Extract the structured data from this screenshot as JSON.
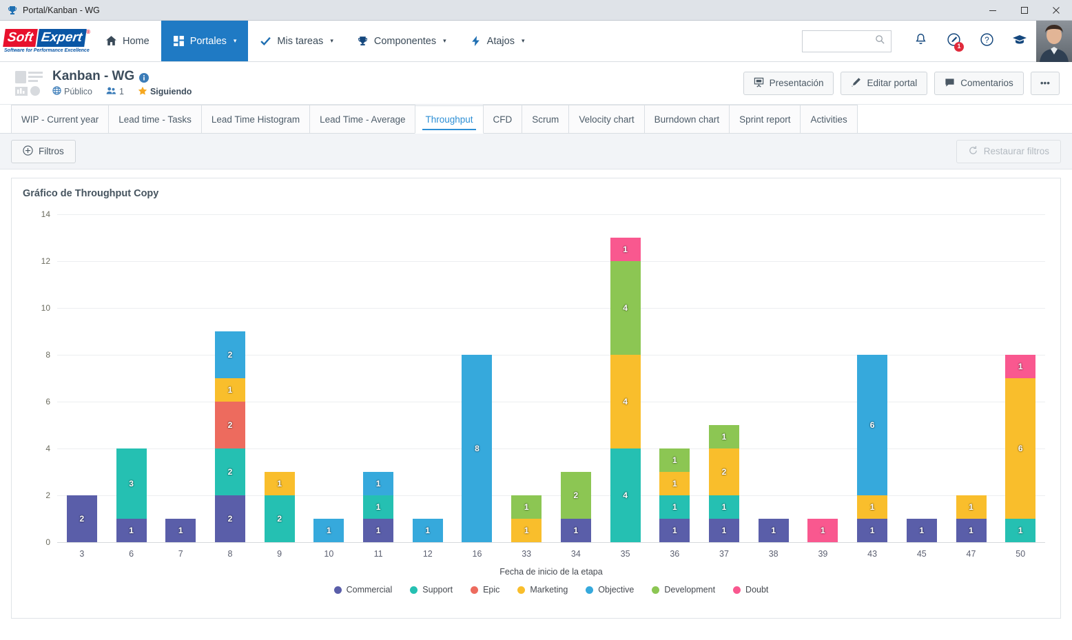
{
  "window": {
    "title": "Portal/Kanban - WG",
    "icon": "trophy-icon",
    "minimize": "—",
    "maximize": "□",
    "close": "×"
  },
  "brand": {
    "soft": "Soft",
    "expert": "Expert",
    "registered": "®",
    "tagline": "Software for Performance Excellence",
    "red": "#e8112d",
    "blue": "#0a56a5"
  },
  "nav": {
    "items": [
      {
        "label": "Home",
        "icon": "home-icon",
        "caret": false,
        "active": false
      },
      {
        "label": "Portales",
        "icon": "grid-icon",
        "caret": true,
        "active": true
      },
      {
        "label": "Mis tareas",
        "icon": "check-icon",
        "caret": true,
        "active": false
      },
      {
        "label": "Componentes",
        "icon": "trophy-icon",
        "caret": true,
        "active": false
      },
      {
        "label": "Atajos",
        "icon": "bolt-icon",
        "caret": true,
        "active": false
      }
    ],
    "caret": "▾",
    "search": {
      "value": "",
      "placeholder": ""
    },
    "icons": [
      {
        "name": "bell-icon",
        "badge": null
      },
      {
        "name": "feedback-icon",
        "badge": "1"
      },
      {
        "name": "help-icon",
        "badge": null
      },
      {
        "name": "academy-icon",
        "badge": null
      }
    ],
    "accent": "#1f7ac4"
  },
  "portal": {
    "title": "Kanban - WG",
    "info_icon": "info-icon",
    "visibility": {
      "icon": "globe-icon",
      "label": "Público"
    },
    "members": {
      "icon": "users-icon",
      "label": "1"
    },
    "following": {
      "icon": "star-icon",
      "label": "Siguiendo"
    },
    "actions": [
      {
        "label": "Presentación",
        "icon": "presentation-icon"
      },
      {
        "label": "Editar portal",
        "icon": "pencil-icon"
      },
      {
        "label": "Comentarios",
        "icon": "comment-icon"
      }
    ],
    "more": "•••"
  },
  "tabs": {
    "items": [
      {
        "label": "WIP - Current year",
        "active": false
      },
      {
        "label": "Lead time - Tasks",
        "active": false
      },
      {
        "label": "Lead Time Histogram",
        "active": false
      },
      {
        "label": "Lead Time - Average",
        "active": false
      },
      {
        "label": "Throughput",
        "active": true
      },
      {
        "label": "CFD",
        "active": false
      },
      {
        "label": "Scrum",
        "active": false
      },
      {
        "label": "Velocity chart",
        "active": false
      },
      {
        "label": "Burndown chart",
        "active": false
      },
      {
        "label": "Sprint report",
        "active": false
      },
      {
        "label": "Activities",
        "active": false
      }
    ]
  },
  "filterbar": {
    "filters_label": "Filtros",
    "filters_icon": "plus-circle-icon",
    "restore_label": "Restaurar filtros",
    "restore_icon": "refresh-icon"
  },
  "chart_data": {
    "type": "bar",
    "stacked": true,
    "title": "Gráfico de Throughput Copy",
    "xlabel": "Fecha de inicio de la etapa",
    "ylabel": "",
    "ylim": [
      0,
      14
    ],
    "yticks": [
      0,
      2,
      4,
      6,
      8,
      10,
      12,
      14
    ],
    "grid": true,
    "legend_position": "bottom",
    "categories": [
      "3",
      "6",
      "7",
      "8",
      "9",
      "10",
      "11",
      "12",
      "16",
      "33",
      "34",
      "35",
      "36",
      "37",
      "38",
      "39",
      "43",
      "45",
      "47",
      "50"
    ],
    "series": [
      {
        "name": "Commercial",
        "color": "#5a5ea9",
        "values": [
          2,
          1,
          1,
          2,
          0,
          0,
          1,
          0,
          0,
          0,
          1,
          0,
          1,
          1,
          1,
          0,
          1,
          1,
          1,
          0
        ]
      },
      {
        "name": "Support",
        "color": "#25c0b2",
        "values": [
          0,
          3,
          0,
          2,
          2,
          0,
          1,
          0,
          0,
          0,
          0,
          4,
          1,
          1,
          0,
          0,
          0,
          0,
          0,
          1
        ]
      },
      {
        "name": "Epic",
        "color": "#ed6b5e",
        "values": [
          0,
          0,
          0,
          2,
          0,
          0,
          0,
          0,
          0,
          0,
          0,
          0,
          0,
          0,
          0,
          0,
          0,
          0,
          0,
          0
        ]
      },
      {
        "name": "Marketing",
        "color": "#f9be2c",
        "values": [
          0,
          0,
          0,
          1,
          1,
          0,
          0,
          0,
          0,
          1,
          0,
          4,
          1,
          2,
          0,
          0,
          1,
          0,
          1,
          6
        ]
      },
      {
        "name": "Objective",
        "color": "#36a9dc",
        "values": [
          0,
          0,
          0,
          2,
          0,
          1,
          1,
          1,
          8,
          0,
          0,
          0,
          0,
          0,
          0,
          0,
          6,
          0,
          0,
          0
        ]
      },
      {
        "name": "Development",
        "color": "#8cc653",
        "values": [
          0,
          0,
          0,
          0,
          0,
          0,
          0,
          0,
          0,
          1,
          2,
          4,
          1,
          1,
          0,
          0,
          0,
          0,
          0,
          0
        ]
      },
      {
        "name": "Doubt",
        "color": "#f9588f",
        "values": [
          0,
          0,
          0,
          0,
          0,
          0,
          0,
          0,
          0,
          0,
          0,
          1,
          0,
          0,
          0,
          1,
          0,
          0,
          0,
          1
        ]
      }
    ]
  }
}
